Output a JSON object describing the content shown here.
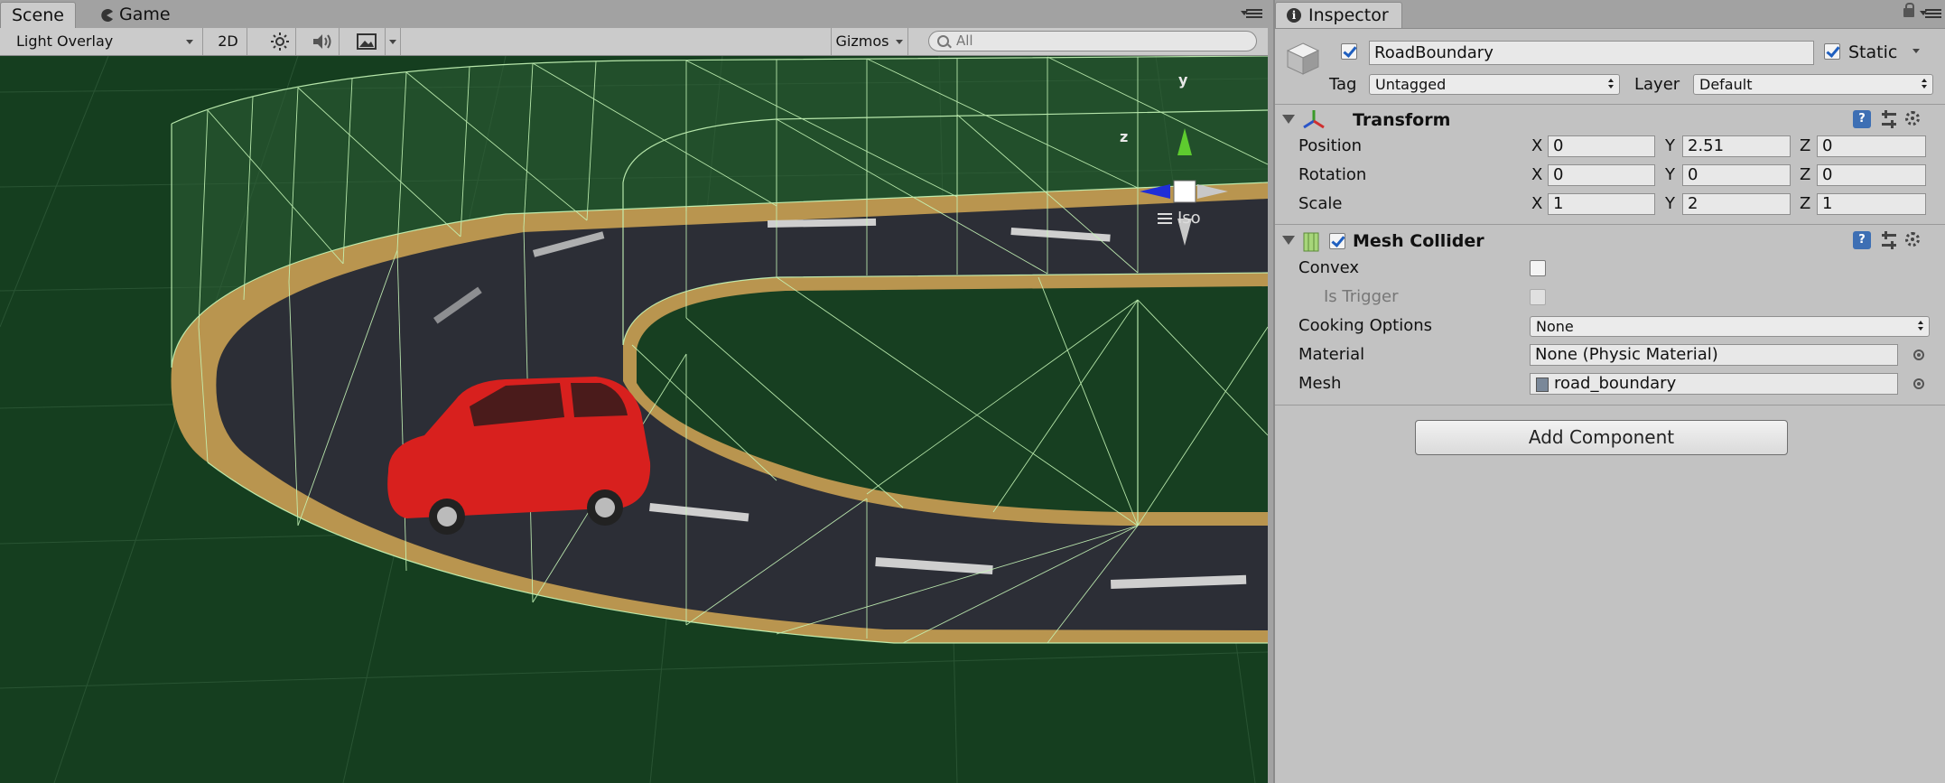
{
  "scene": {
    "tabs": [
      {
        "label": "Scene",
        "icon": "grid-icon",
        "active": true
      },
      {
        "label": "Game",
        "icon": "pacman-icon",
        "active": false
      }
    ],
    "toolbar": {
      "draw_mode": "Light Overlay",
      "mode_2d": "2D",
      "gizmos": "Gizmos",
      "search_placeholder": "All"
    },
    "gizmo": {
      "y_label": "y",
      "z_label": "z",
      "view_label": "Iso"
    }
  },
  "inspector": {
    "tab_label": "Inspector",
    "object": {
      "active": true,
      "name": "RoadBoundary",
      "static_checked": true,
      "static_label": "Static"
    },
    "tag_label": "Tag",
    "tag_value": "Untagged",
    "layer_label": "Layer",
    "layer_value": "Default",
    "transform": {
      "title": "Transform",
      "rows": [
        {
          "label": "Position",
          "x": "0",
          "y": "2.51",
          "z": "0"
        },
        {
          "label": "Rotation",
          "x": "0",
          "y": "0",
          "z": "0"
        },
        {
          "label": "Scale",
          "x": "1",
          "y": "2",
          "z": "1"
        }
      ],
      "axis_labels": {
        "x": "X",
        "y": "Y",
        "z": "Z"
      }
    },
    "mesh_collider": {
      "title": "Mesh Collider",
      "enabled": true,
      "convex_label": "Convex",
      "convex_checked": false,
      "is_trigger_label": "Is Trigger",
      "is_trigger_checked": false,
      "cooking_label": "Cooking Options",
      "cooking_value": "None",
      "material_label": "Material",
      "material_value": "None (Physic Material)",
      "mesh_label": "Mesh",
      "mesh_value": "road_boundary"
    },
    "add_component": "Add Component"
  },
  "colors": {
    "viewport_bg": "#153e1f",
    "wire": "#bff0b0",
    "road": "#2c2e36",
    "curb": "#b9954f",
    "car": "#d8201e",
    "accent_blue": "#3d6fb4"
  }
}
